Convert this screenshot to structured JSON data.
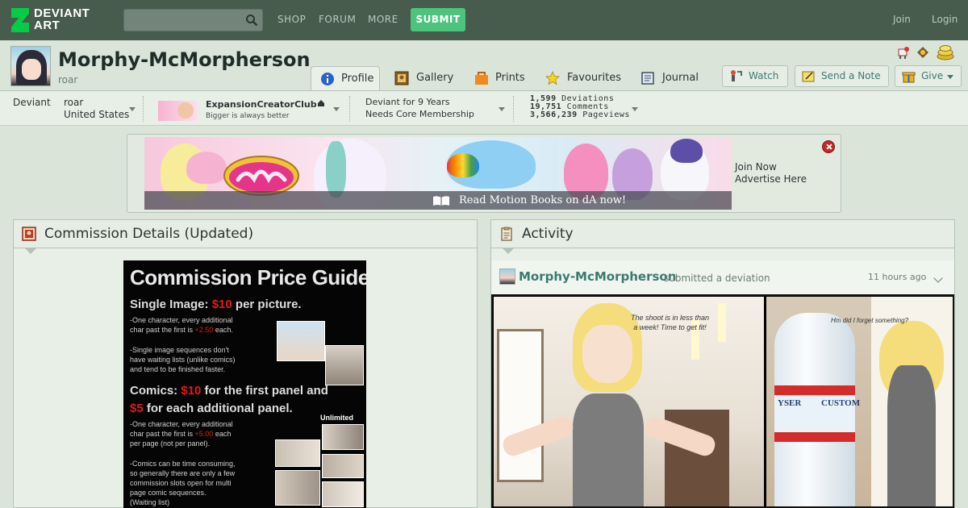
{
  "topbar": {
    "logo_text": "DEVIANT\nART",
    "nav": [
      "SHOP",
      "FORUM",
      "MORE"
    ],
    "submit_label": "SUBMIT",
    "join_label": "Join",
    "login_label": "Login",
    "accent": "#4dc47d"
  },
  "profile": {
    "username": "Morphy-McMorpherson",
    "tagline": "roar",
    "tabs": [
      {
        "label": "Profile",
        "icon": "info-icon"
      },
      {
        "label": "Gallery",
        "icon": "gallery-icon"
      },
      {
        "label": "Prints",
        "icon": "prints-icon"
      },
      {
        "label": "Favourites",
        "icon": "star-icon"
      },
      {
        "label": "Journal",
        "icon": "journal-icon"
      }
    ],
    "buttons": {
      "watch": "Watch",
      "note": "Send a Note",
      "give": "Give"
    }
  },
  "infobar": {
    "type_label": "Deviant",
    "name": "roar",
    "country": "United States",
    "club_name": "ExpansionCreatorClub",
    "club_tagline": "Bigger is always better",
    "tenure": "Deviant for 9 Years",
    "membership": "Needs Core Membership",
    "stats": [
      {
        "value": "1,599",
        "label": "Deviations"
      },
      {
        "value": "19,751",
        "label": "Comments"
      },
      {
        "value": "3,566,239",
        "label": "Pageviews"
      }
    ]
  },
  "ad": {
    "strip_text": "Read Motion Books on dA now!",
    "join_now": "Join Now",
    "advertise": "Advertise Here"
  },
  "commission": {
    "title": "Commission Details (Updated)",
    "poster": {
      "heading": "Commission Price Guide!",
      "line1_a": "Single Image: ",
      "line1_price": "$10",
      "line1_b": " per picture.",
      "note1": "-One character, every additional\nchar past the first is ",
      "note1_price": "+2.50",
      "note1_end": " each.",
      "note2": "-Single image sequences don't\nhave waiting lists (unlike comics)\nand tend to be finished faster.",
      "line2_a": "Comics: ",
      "line2_price": "$10",
      "line2_b": " for the first panel and",
      "line3_price": "$5",
      "line3_b": " for each additional panel.",
      "unlimited": "Unlimited",
      "note3": "-One character, every additional\nchar past the first is ",
      "note3_price": "+5.00",
      "note3_end": " each\nper page (not per panel).",
      "note4": "-Comics can be time consuming,\nso generally there are only a few\ncommission slots open for multi\npage comic sequences.\n(Waiting list)"
    }
  },
  "activity": {
    "title": "Activity",
    "user": "Morphy-McMorpherson",
    "verb": "submitted a deviation",
    "time": "11 hours ago",
    "bubble1": "The shoot is in less than\na week! Time to get fit!",
    "bubble2": "Hm did I forget something?",
    "bottle_label": "CUSTOM",
    "bottle_label_2": "YSER"
  }
}
